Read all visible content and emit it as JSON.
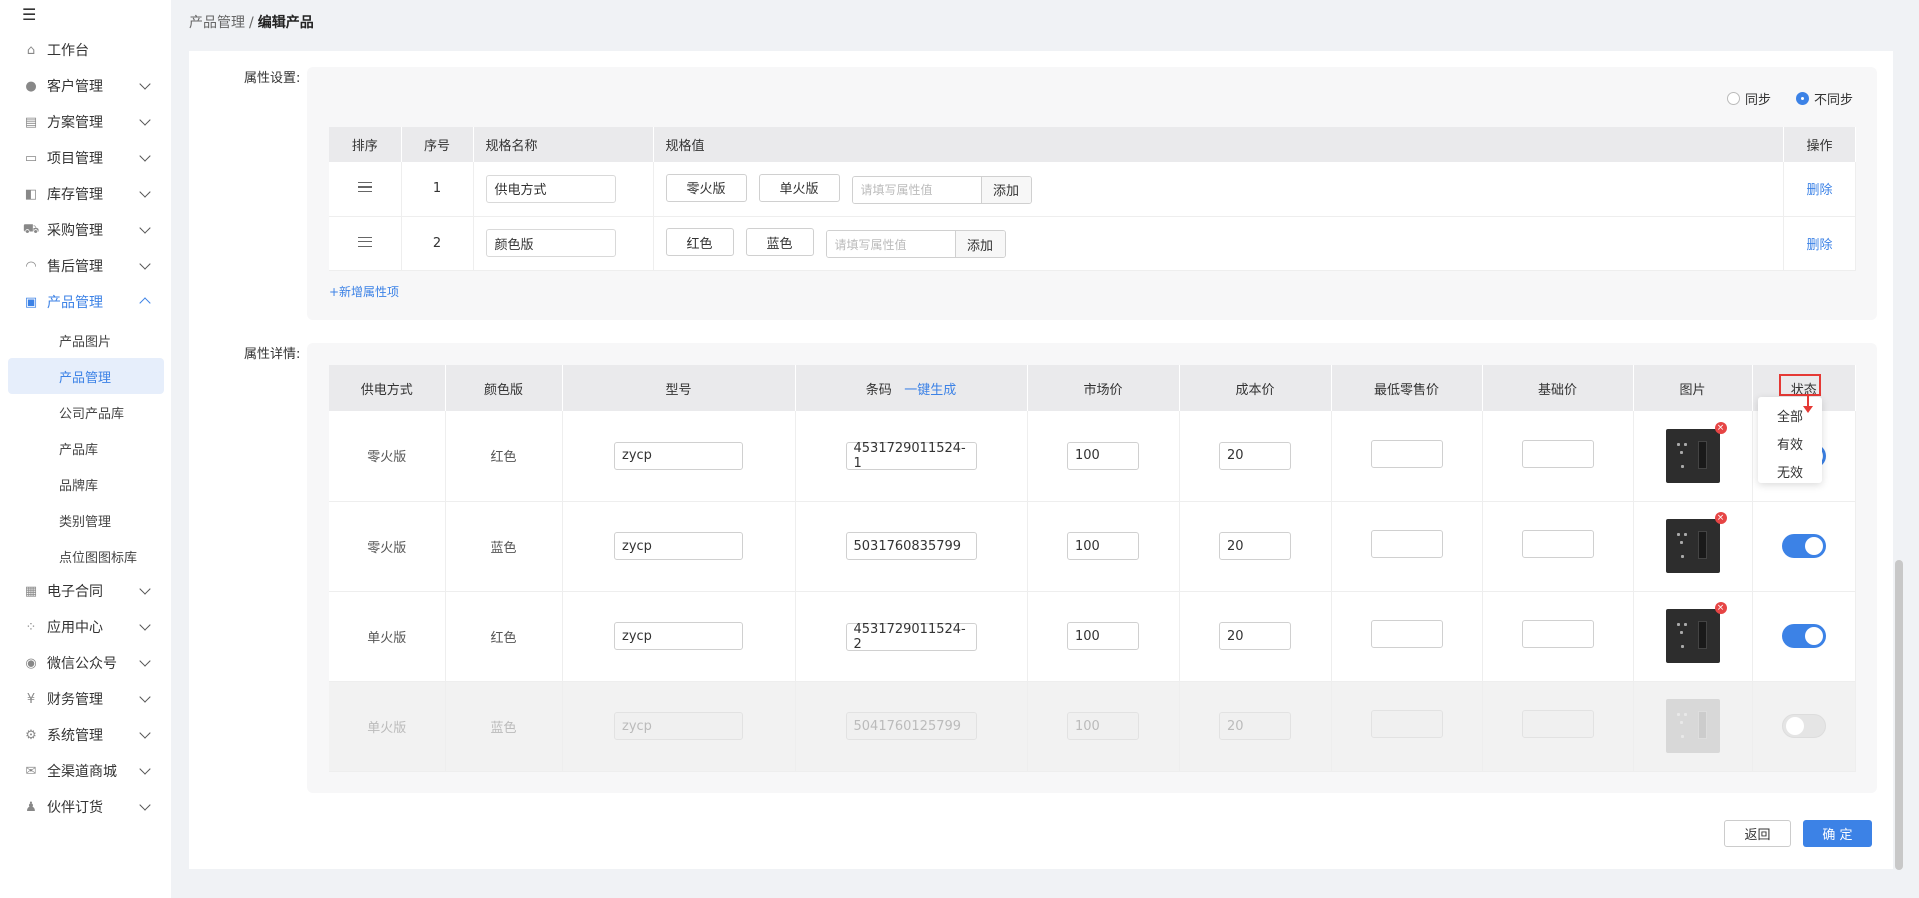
{
  "sidebar": {
    "items": [
      {
        "label": "工作台",
        "icon": "home-icon"
      },
      {
        "label": "客户管理",
        "icon": "customer-icon"
      },
      {
        "label": "方案管理",
        "icon": "plan-icon"
      },
      {
        "label": "项目管理",
        "icon": "folder-icon"
      },
      {
        "label": "库存管理",
        "icon": "inventory-icon"
      },
      {
        "label": "采购管理",
        "icon": "cart-icon"
      },
      {
        "label": "售后管理",
        "icon": "headset-icon"
      },
      {
        "label": "产品管理",
        "icon": "product-icon"
      },
      {
        "label": "电子合同",
        "icon": "contract-icon"
      },
      {
        "label": "应用中心",
        "icon": "apps-icon"
      },
      {
        "label": "微信公众号",
        "icon": "wechat-icon"
      },
      {
        "label": "财务管理",
        "icon": "finance-icon"
      },
      {
        "label": "系统管理",
        "icon": "settings-icon"
      },
      {
        "label": "全渠道商城",
        "icon": "mall-icon"
      },
      {
        "label": "伙伴订货",
        "icon": "partner-icon"
      }
    ],
    "product_sub": [
      "产品图片",
      "产品管理",
      "公司产品库",
      "产品库",
      "品牌库",
      "类别管理",
      "点位图图标库"
    ]
  },
  "breadcrumb": {
    "parent": "产品管理",
    "sep": "/",
    "current": "编辑产品"
  },
  "attr_settings": {
    "label": "属性设置:",
    "radio_sync": "同步",
    "radio_nosync": "不同步",
    "selected": "不同步",
    "headers": [
      "排序",
      "序号",
      "规格名称",
      "规格值",
      "操作"
    ],
    "rows": [
      {
        "index": "1",
        "name": "供电方式",
        "values": [
          "零火版",
          "单火版"
        ],
        "placeholder": "请填写属性值",
        "add": "添加",
        "action": "删除"
      },
      {
        "index": "2",
        "name": "颜色版",
        "values": [
          "红色",
          "蓝色"
        ],
        "placeholder": "请填写属性值",
        "add": "添加",
        "action": "删除"
      }
    ],
    "add_attr": "+新增属性项"
  },
  "attr_detail": {
    "label": "属性详情:",
    "headers": {
      "power": "供电方式",
      "color": "颜色版",
      "model": "型号",
      "barcode": "条码",
      "barcode_gen": "一键生成",
      "market": "市场价",
      "cost": "成本价",
      "min_retail": "最低零售价",
      "base": "基础价",
      "image": "图片",
      "status": "状态"
    },
    "rows": [
      {
        "power": "零火版",
        "color": "红色",
        "model": "zycp",
        "barcode": "4531729011524-1",
        "market": "100",
        "cost": "20",
        "min_retail": "",
        "base": "",
        "enabled": true
      },
      {
        "power": "零火版",
        "color": "蓝色",
        "model": "zycp",
        "barcode": "5031760835799",
        "market": "100",
        "cost": "20",
        "min_retail": "",
        "base": "",
        "enabled": true
      },
      {
        "power": "单火版",
        "color": "红色",
        "model": "zycp",
        "barcode": "4531729011524-2",
        "market": "100",
        "cost": "20",
        "min_retail": "",
        "base": "",
        "enabled": true
      },
      {
        "power": "单火版",
        "color": "蓝色",
        "model": "zycp",
        "barcode": "5041760125799",
        "market": "100",
        "cost": "20",
        "min_retail": "",
        "base": "",
        "enabled": false
      }
    ],
    "status_filter_options": [
      "全部",
      "有效",
      "无效"
    ]
  },
  "footer": {
    "back": "返回",
    "ok": "确 定"
  },
  "colors": {
    "accent": "#3c82e6",
    "danger": "#e53935"
  }
}
